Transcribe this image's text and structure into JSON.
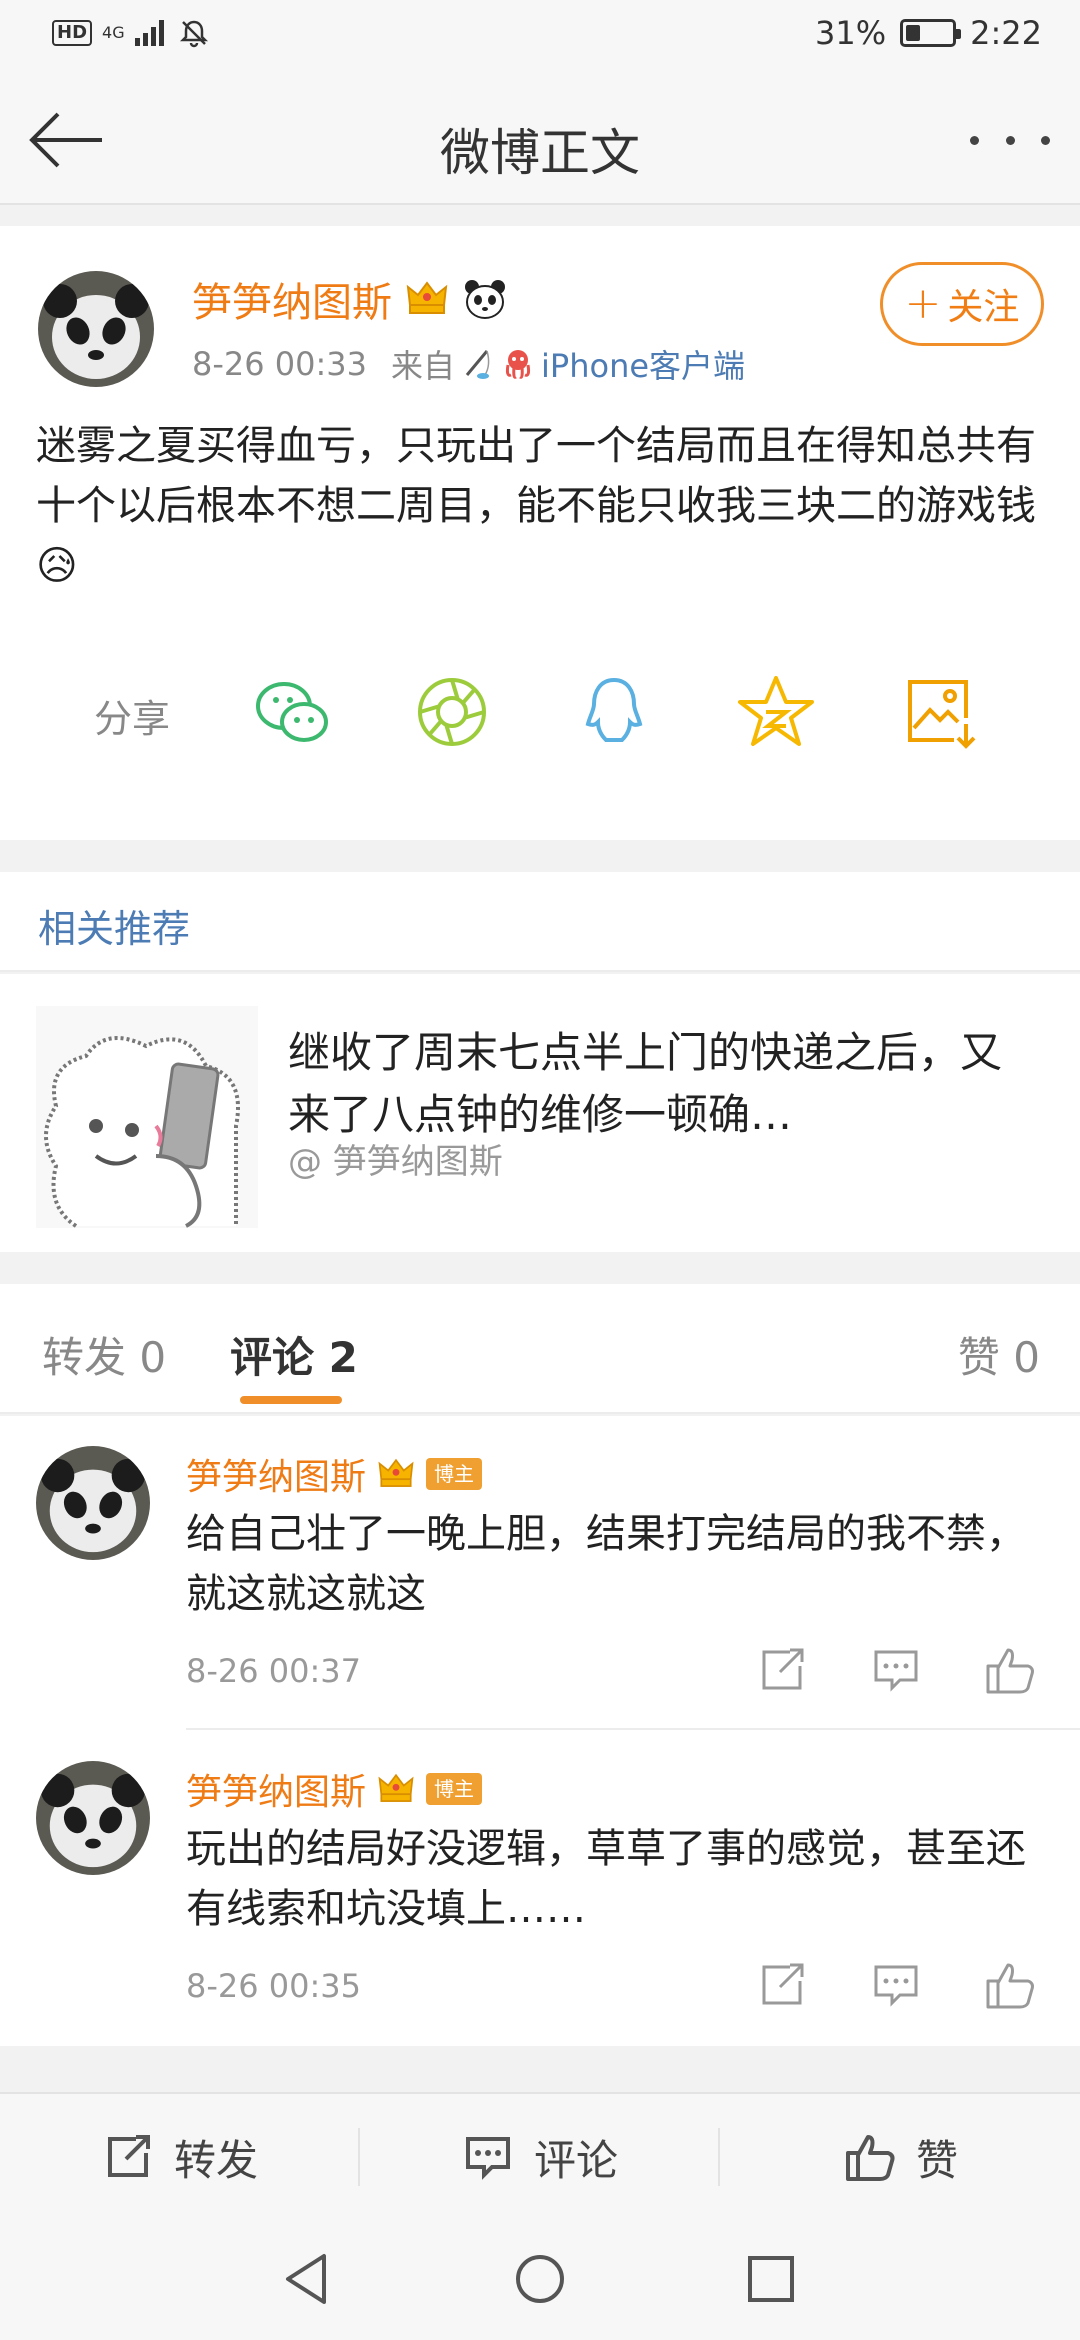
{
  "status_bar": {
    "network": "HD",
    "signal": "4G",
    "battery_level": 0.31,
    "battery_percent": "31%",
    "time": "2:22"
  },
  "nav": {
    "title": "微博正文"
  },
  "post": {
    "author": "笋笋纳图斯",
    "time": "8-26 00:33",
    "source_prefix": "来自",
    "source": "iPhone客户端",
    "follow_label": "关注",
    "text": "迷雾之夏买得血亏，只玩出了一个结局而且在得知总共有十个以后根本不想二周目，能不能只收我三块二的游戏钱😥",
    "share_label": "分享"
  },
  "related": {
    "title": "相关推荐",
    "item_text": "继收了周末七点半上门的快递之后，又来了八点钟的维修一顿确…",
    "item_author": "@ 笋笋纳图斯"
  },
  "tabs": {
    "repost": "转发 0",
    "comments": "评论 2",
    "likes": "赞 0"
  },
  "comments": [
    {
      "author": "笋笋纳图斯",
      "tag": "博主",
      "text": "给自己壮了一晚上胆，结果打完结局的我不禁，就这就这就这",
      "time": "8-26 00:37"
    },
    {
      "author": "笋笋纳图斯",
      "tag": "博主",
      "text": "玩出的结局好没逻辑，草草了事的感觉，甚至还有线索和坑没填上……",
      "time": "8-26 00:35"
    }
  ],
  "bottom_bar": {
    "repost": "转发",
    "comment": "评论",
    "like": "赞"
  },
  "colors": {
    "accent": "#f07e14",
    "link": "#4c7cb3",
    "wechat": "#3cb96e",
    "moments": "#9ccc3c",
    "qq": "#5ab0e0",
    "favorite": "#f6b800",
    "save": "#f0a000"
  }
}
